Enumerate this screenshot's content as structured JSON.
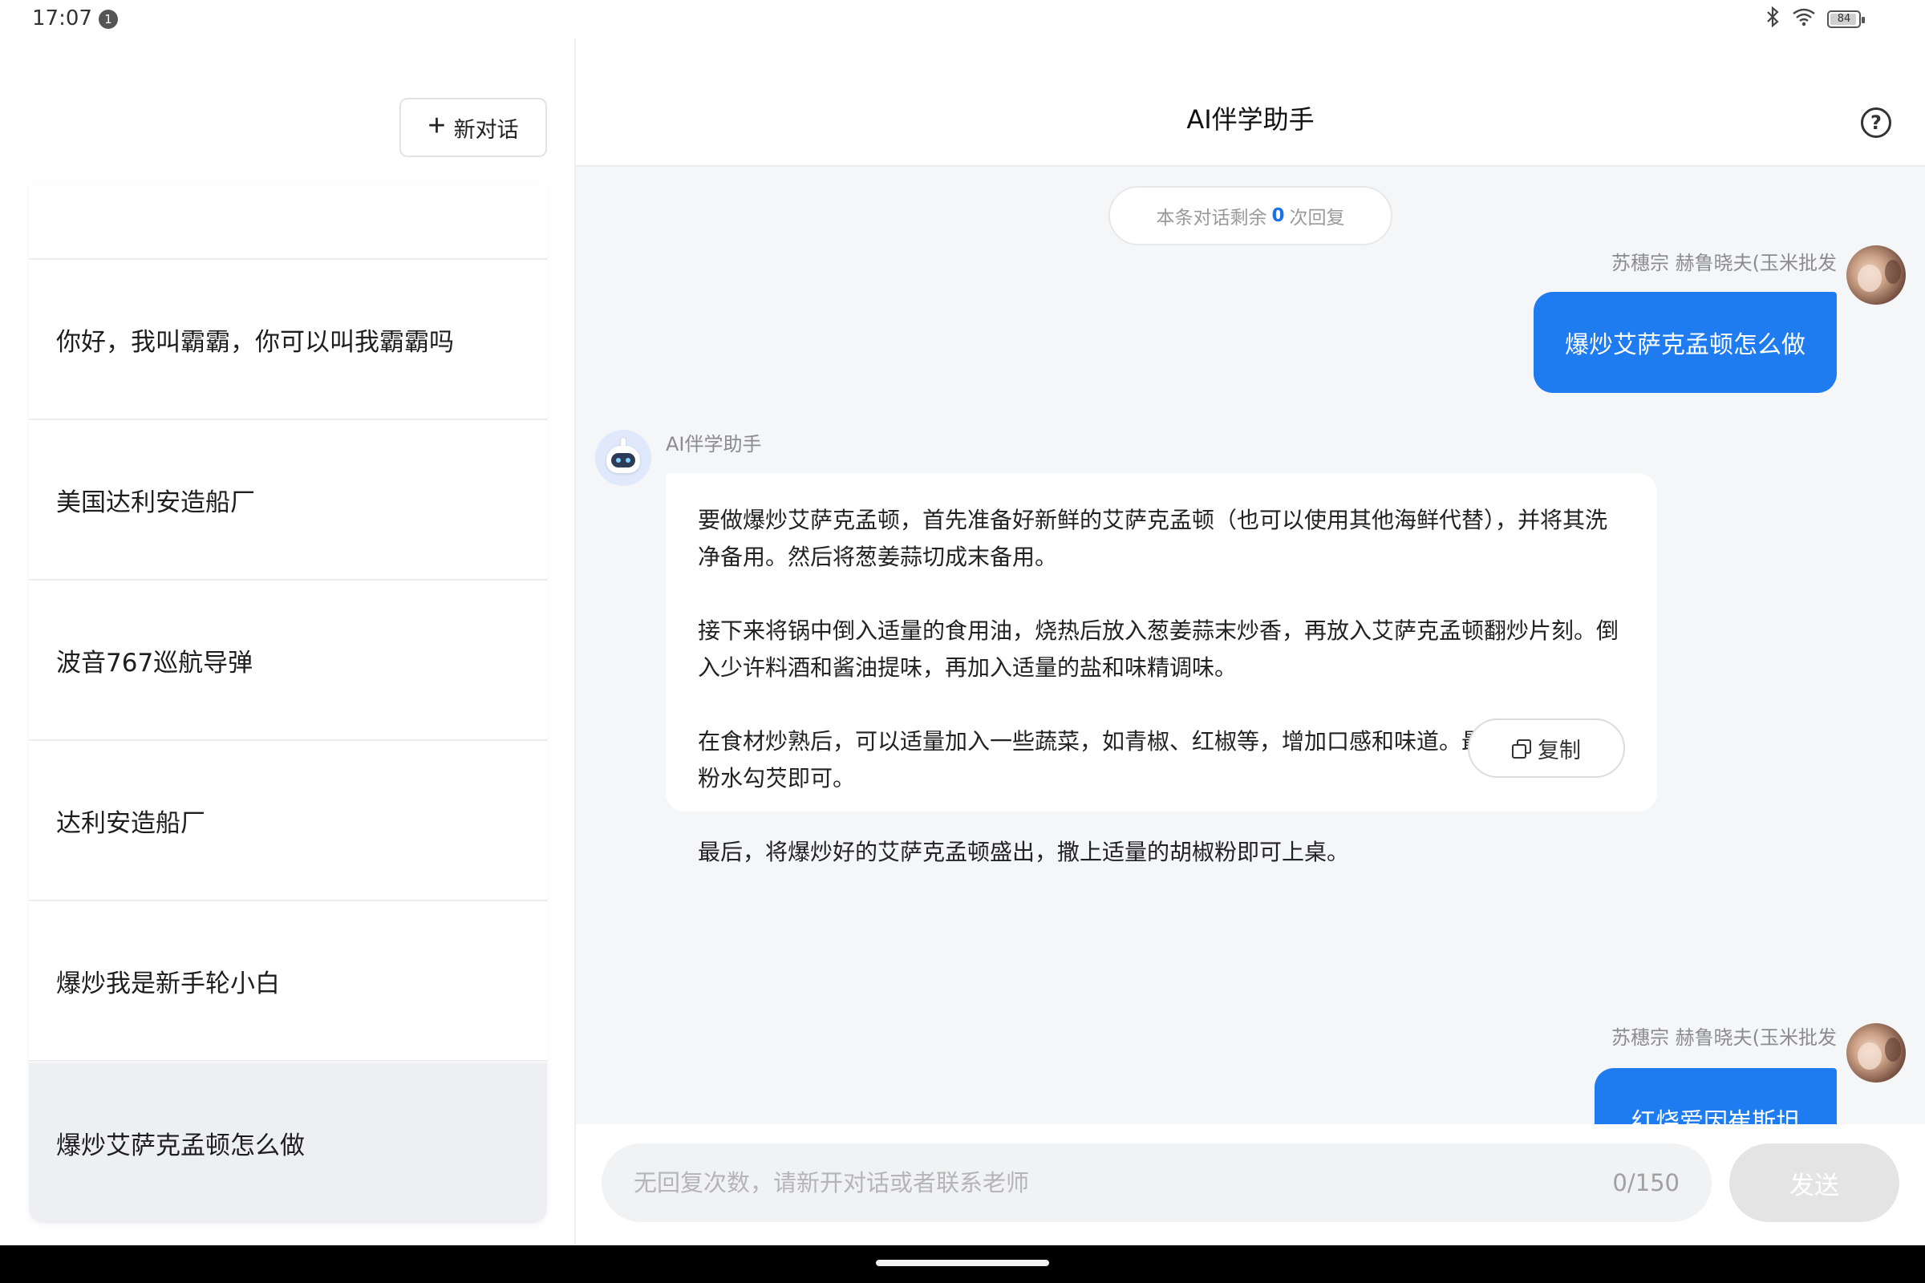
{
  "status_bar": {
    "time": "17:07",
    "notification_count": "1",
    "battery_level": "84",
    "battery_fraction": 0.84
  },
  "sidebar": {
    "new_chat_label": "新对话",
    "history": [
      {
        "label": "…"
      },
      {
        "label": "你好，我叫霸霸，你可以叫我霸霸吗"
      },
      {
        "label": "美国达利安造船厂"
      },
      {
        "label": "波音767巡航导弹"
      },
      {
        "label": "达利安造船厂"
      },
      {
        "label": "爆炒我是新手轮小白"
      },
      {
        "label": "爆炒艾萨克孟顿怎么做",
        "active": true
      }
    ]
  },
  "header": {
    "title": "AI伴学助手",
    "help_icon": "question-circle-icon"
  },
  "chat": {
    "remaining_prefix": "本条对话剩余",
    "remaining_count": "0",
    "remaining_suffix": "次回复",
    "messages": [
      {
        "role": "user",
        "name": "苏穗宗 赫鲁晓夫(玉米批发",
        "text": "爆炒艾萨克孟顿怎么做"
      },
      {
        "role": "assistant",
        "name": "AI伴学助手",
        "paragraphs": [
          "要做爆炒艾萨克孟顿，首先准备好新鲜的艾萨克孟顿（也可以使用其他海鲜代替），并将其洗净备用。然后将葱姜蒜切成末备用。",
          "接下来将锅中倒入适量的食用油，烧热后放入葱姜蒜末炒香，再放入艾萨克孟顿翻炒片刻。倒入少许料酒和酱油提味，再加入适量的盐和味精调味。",
          "在食材炒熟后，可以适量加入一些蔬菜，如青椒、红椒等，增加口感和味道。最后加入一些淀粉水勾芡即可。",
          "最后，将爆炒好的艾萨克孟顿盛出，撒上适量的胡椒粉即可上桌。"
        ],
        "copy_label": "复制"
      },
      {
        "role": "user",
        "name": "苏穗宗 赫鲁晓夫(玉米批发",
        "text": "红烧爱因崔斯坦"
      }
    ]
  },
  "input": {
    "placeholder": "无回复次数，请新开对话或者联系老师",
    "value": "",
    "char_count": "0/150",
    "send_label": "发送"
  },
  "colors": {
    "accent": "#1f7cf0",
    "chat_bg": "#f5f6f8",
    "send_disabled": "#e4e4e4"
  }
}
